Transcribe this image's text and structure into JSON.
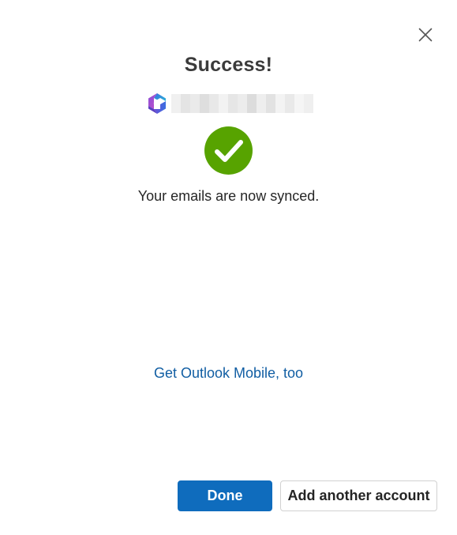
{
  "dialog": {
    "title": "Success!",
    "account": {
      "logo_icon": "microsoft-365-logo-icon",
      "email_redacted": true
    },
    "status_icon": "checkmark-circle-icon",
    "message": "Your emails are now synced.",
    "mobile_link": "Get Outlook Mobile, too",
    "buttons": {
      "done_label": "Done",
      "add_account_label": "Add another account"
    },
    "close_icon": "close-icon"
  },
  "colors": {
    "success_green": "#57a300",
    "primary_blue": "#0f6cbd",
    "link_blue": "#115ea3",
    "title_text": "#3b3b3b",
    "body_text": "#262626"
  }
}
